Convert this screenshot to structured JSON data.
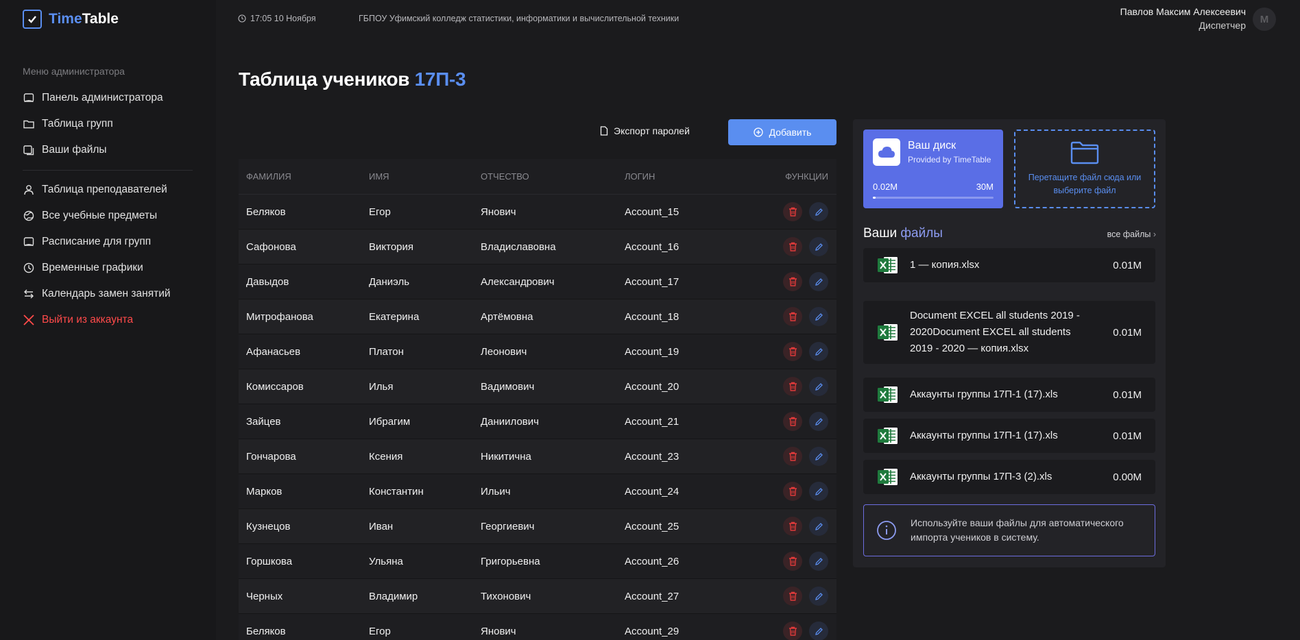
{
  "app": {
    "name_part1": "Time",
    "name_part2": "Table"
  },
  "header": {
    "time": "17:05 10 Ноября",
    "organization": "ГБПОУ Уфимский колледж статистики, информатики и вычислительной техники",
    "user_name": "Павлов Максим Алексеевич",
    "user_role": "Диспетчер",
    "avatar_letter": "М"
  },
  "sidebar": {
    "menu_title": "Меню администратора",
    "items": [
      {
        "label": "Панель администратора",
        "icon": "panel-icon"
      },
      {
        "label": "Таблица групп",
        "icon": "folder-icon"
      },
      {
        "label": "Ваши файлы",
        "icon": "files-icon"
      },
      {
        "label": "Таблица преподавателей",
        "icon": "user-icon"
      },
      {
        "label": "Все учебные предметы",
        "icon": "globe-icon"
      },
      {
        "label": "Расписание для групп",
        "icon": "schedule-icon"
      },
      {
        "label": "Временные графики",
        "icon": "clock-icon"
      },
      {
        "label": "Календарь замен занятий",
        "icon": "swap-icon"
      }
    ],
    "logout": "Выйти из аккаунта"
  },
  "page": {
    "title": "Таблица учеников",
    "group": "17П-3"
  },
  "actions": {
    "export_label": "Экспорт паролей",
    "add_label": "Добавить"
  },
  "table": {
    "headers": [
      "ФАМИЛИЯ",
      "ИМЯ",
      "ОТЧЕСТВО",
      "ЛОГИН",
      "ФУНКЦИИ"
    ],
    "rows": [
      [
        "Беляков",
        "Егор",
        "Янович",
        "Account_15"
      ],
      [
        "Сафонова",
        "Виктория",
        "Владиславовна",
        "Account_16"
      ],
      [
        "Давыдов",
        "Даниэль",
        "Александрович",
        "Account_17"
      ],
      [
        "Митрофанова",
        "Екатерина",
        "Артёмовна",
        "Account_18"
      ],
      [
        "Афанасьев",
        "Платон",
        "Леонович",
        "Account_19"
      ],
      [
        "Комиссаров",
        "Илья",
        "Вадимович",
        "Account_20"
      ],
      [
        "Зайцев",
        "Ибрагим",
        "Даниилович",
        "Account_21"
      ],
      [
        "Гончарова",
        "Ксения",
        "Никитична",
        "Account_23"
      ],
      [
        "Марков",
        "Константин",
        "Ильич",
        "Account_24"
      ],
      [
        "Кузнецов",
        "Иван",
        "Георгиевич",
        "Account_25"
      ],
      [
        "Горшкова",
        "Ульяна",
        "Григорьевна",
        "Account_26"
      ],
      [
        "Черных",
        "Владимир",
        "Тихонович",
        "Account_27"
      ],
      [
        "Беляков",
        "Егор",
        "Янович",
        "Account_29"
      ]
    ]
  },
  "disk": {
    "title": "Ваш диск",
    "subtitle": "Provided by TimeTable",
    "used": "0.02M",
    "total": "30M",
    "usage_fraction": 0.02
  },
  "dropzone": {
    "text": "Перетащите файл сюда или выберите файл"
  },
  "files": {
    "title_part1": "Ваши",
    "title_part2": "файлы",
    "all_files_label": "все файлы",
    "items": [
      {
        "name": "1 — копия.xlsx",
        "size": "0.01M"
      },
      {
        "name": "Document EXCEL all students 2019 - 2020Document EXCEL all students 2019 - 2020 — копия.xlsx",
        "size": "0.01M"
      },
      {
        "name": "Аккаунты группы 17П-1 (17).xls",
        "size": "0.01M"
      },
      {
        "name": "Аккаунты группы 17П-1 (17).xls",
        "size": "0.01M"
      },
      {
        "name": "Аккаунты группы 17П-3 (2).xls",
        "size": "0.00M"
      }
    ]
  },
  "info": {
    "text": "Используйте ваши файлы для автоматического импорта учеников в систему."
  },
  "colors": {
    "accent": "#5a8ef0",
    "danger": "#ff4a4a",
    "disk_card": "#5a6ee6",
    "excel": "#1f7a3d"
  }
}
